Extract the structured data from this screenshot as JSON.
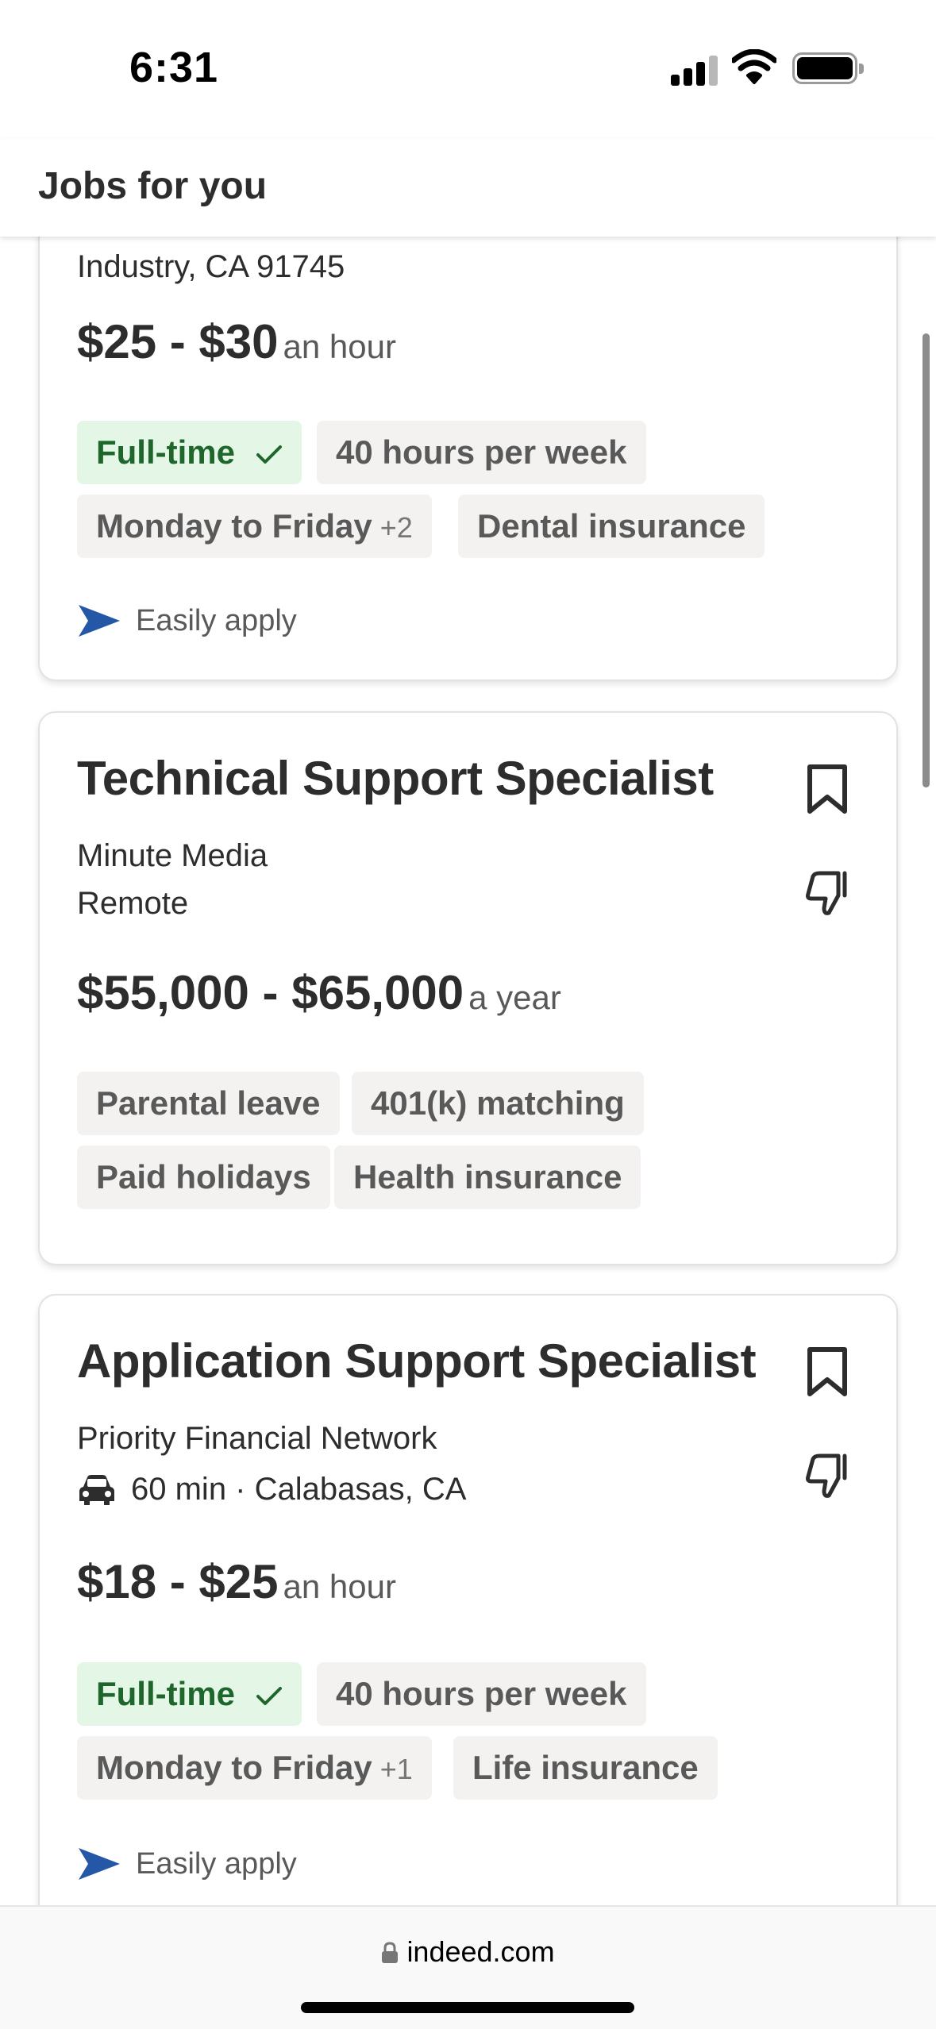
{
  "status_bar": {
    "time": "6:31"
  },
  "header": {
    "title": "Jobs for you"
  },
  "jobs": [
    {
      "location": "Industry, CA 91745",
      "salary": "$25 - $30",
      "period": "an hour",
      "tags": [
        {
          "label": "Full-time",
          "checked": true
        },
        {
          "label": "40 hours per week"
        },
        {
          "label": "Monday to Friday",
          "extra": "+2"
        },
        {
          "label": "Dental insurance"
        }
      ],
      "easily_apply": "Easily apply"
    },
    {
      "title": "Technical Support Specialist",
      "company": "Minute Media",
      "location": "Remote",
      "salary": "$55,000 - $65,000",
      "period": "a year",
      "tags": [
        {
          "label": "Parental leave"
        },
        {
          "label": "401(k) matching"
        },
        {
          "label": "Paid holidays"
        },
        {
          "label": "Health insurance"
        }
      ]
    },
    {
      "title": "Application Support Specialist",
      "company": "Priority Financial Network",
      "commute": "60 min · Calabasas, CA",
      "salary": "$18 - $25",
      "period": "an hour",
      "tags": [
        {
          "label": "Full-time",
          "checked": true
        },
        {
          "label": "40 hours per week"
        },
        {
          "label": "Monday to Friday",
          "extra": "+1"
        },
        {
          "label": "Life insurance"
        }
      ],
      "easily_apply": "Easily apply"
    }
  ],
  "browser": {
    "url": "indeed.com"
  },
  "colors": {
    "accent_blue": "#2557a7",
    "tag_green_bg": "#e4f7e6",
    "tag_green_text": "#1f662c",
    "tag_bg": "#f3f2f1"
  }
}
